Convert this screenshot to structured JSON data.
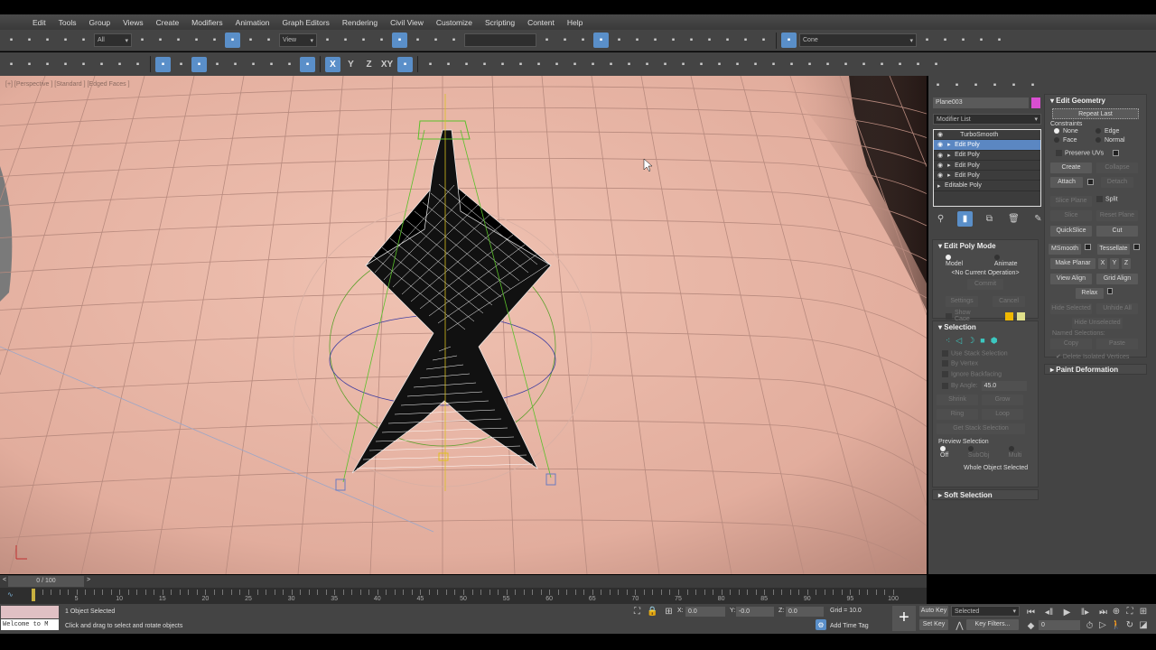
{
  "menu": [
    "Edit",
    "Tools",
    "Group",
    "Views",
    "Create",
    "Modifiers",
    "Animation",
    "Graph Editors",
    "Rendering",
    "Civil View",
    "Customize",
    "Scripting",
    "Content",
    "Help"
  ],
  "toolbar1": {
    "icons_left": [
      "undo-icon",
      "redo-icon",
      "link-icon",
      "unlink-icon",
      "bind-space-warp-icon"
    ],
    "selection_filter": "All",
    "icons_mid": [
      "select-object-icon",
      "select-by-name-icon",
      "rectangular-selection-icon",
      "window-crossing-icon",
      "move-icon",
      "rotate-icon",
      "scale-icon",
      "place-icon"
    ],
    "ref_coord": "View",
    "icons_right": [
      "pivot-center-icon",
      "manipulate-icon",
      "keyboard-shortcut-icon",
      "snap-3d-icon",
      "angle-snap-icon",
      "percent-snap-icon",
      "spinner-snap-icon",
      "named-selection-icon"
    ],
    "icons_far": [
      "mirror-icon",
      "align-icon",
      "scene-explorer-icon",
      "layer-explorer-icon",
      "toggle-ribbon-icon",
      "curve-editor-icon",
      "schematic-view-icon",
      "material-editor-icon",
      "render-setup-icon",
      "rendered-frame-icon",
      "render-icon",
      "render-cloud-icon",
      "render-pane-icon"
    ],
    "layer_label": "Cone",
    "icons_end": [
      "layer-icon",
      "create-layer-icon",
      "add-to-layer-icon",
      "select-in-layer-icon",
      "layer-props-icon"
    ]
  },
  "toolbar2": {
    "icons": [
      "scene-states-icon",
      "sphere-icon",
      "shirt-icon",
      "eraser-icon",
      "bone-icon",
      "keyframe-1-icon",
      "keyframe-2-icon",
      "keyframe-3-icon",
      "vertex-snap-icon",
      "pivot-snap-icon",
      "edge-snap-icon",
      "face-snap-icon",
      "polygon-snap-icon",
      "element-snap-icon",
      "perpendicular-snap-icon",
      "freeze-snap-icon",
      "axis-constraint-snap-icon"
    ],
    "axis": [
      "X",
      "Y",
      "Z",
      "XY"
    ],
    "icons2": [
      "grid-array-icon",
      "spacing-icon",
      "clone-icon",
      "teapot-icon",
      "render-frame-icon",
      "table-icon",
      "table2-icon",
      "light-icon",
      "camera-icon",
      "sound-icon",
      "film-icon",
      "plane-icon",
      "dome-icon",
      "disc-icon",
      "teapot-small-icon",
      "cone-icon",
      "sun-icon",
      "disc2-icon",
      "particles-icon",
      "molecule-icon",
      "pyramid-icon",
      "geosphere-icon",
      "grass-icon",
      "hair-icon",
      "cloth-icon",
      "sphere2-icon",
      "grid-window-icon",
      "info-icon",
      "help-icon"
    ]
  },
  "viewport": {
    "label": "[+] [Perspective ] [Standard ] [Edged Faces ]"
  },
  "command_panel": {
    "tabs": [
      "create-tab-icon",
      "modify-tab-icon",
      "hierarchy-tab-icon",
      "motion-tab-icon",
      "display-tab-icon",
      "utilities-tab-icon"
    ],
    "object_name": "Plane003",
    "object_color": "#d94fd1",
    "modifier_list": "Modifier List",
    "stack": [
      {
        "label": "TurboSmooth",
        "selected": false
      },
      {
        "label": "Edit Poly",
        "selected": true
      },
      {
        "label": "Edit Poly",
        "selected": false
      },
      {
        "label": "Edit Poly",
        "selected": false
      },
      {
        "label": "Edit Poly",
        "selected": false
      },
      {
        "label": "Editable Poly",
        "selected": false
      }
    ],
    "edit_poly_mode": {
      "title": "Edit Poly Mode",
      "model": "Model",
      "animate": "Animate",
      "operation": "<No Current Operation>",
      "commit": "Commit",
      "settings": "Settings",
      "cancel": "Cancel",
      "show_cage": "Show Cage"
    },
    "selection": {
      "title": "Selection",
      "use_stack": "Use Stack Selection",
      "by_vertex": "By Vertex",
      "ignore_backfacing": "Ignore Backfacing",
      "by_angle": "By Angle:",
      "angle": "45.0",
      "shrink": "Shrink",
      "grow": "Grow",
      "ring": "Ring",
      "loop": "Loop",
      "get_stack": "Get Stack Selection",
      "preview": "Preview Selection",
      "off": "Off",
      "subobj": "SubObj",
      "multi": "Multi",
      "status": "Whole Object Selected"
    },
    "soft_selection": "Soft Selection",
    "edit_geometry": {
      "title": "Edit Geometry",
      "repeat_last": "Repeat Last",
      "constraints": "Constraints",
      "none": "None",
      "edge": "Edge",
      "face": "Face",
      "normal": "Normal",
      "preserve_uvs": "Preserve UVs",
      "create": "Create",
      "collapse": "Collapse",
      "attach": "Attach",
      "detach": "Detach",
      "slice_plane": "Slice Plane",
      "split": "Split",
      "slice": "Slice",
      "reset_plane": "Reset Plane",
      "quickslice": "QuickSlice",
      "cut": "Cut",
      "msmooth": "MSmooth",
      "tessellate": "Tessellate",
      "make_planar": "Make Planar",
      "x": "X",
      "y": "Y",
      "z": "Z",
      "view_align": "View Align",
      "grid_align": "Grid Align",
      "relax": "Relax",
      "hide_selected": "Hide Selected",
      "unhide_all": "Unhide All",
      "hide_unselected": "Hide Unselected",
      "named_selections": "Named Selections:",
      "copy": "Copy",
      "paste": "Paste",
      "delete_isolated": "Delete Isolated Vertices"
    },
    "paint_deformation": "Paint Deformation"
  },
  "timeline": {
    "frame": "0 / 100",
    "prev": "<",
    "next": ">",
    "current": 0,
    "total": 100,
    "ticks": [
      "5",
      "10",
      "15",
      "20",
      "25",
      "30",
      "35",
      "40",
      "45",
      "50",
      "55",
      "60",
      "65",
      "70",
      "75",
      "80",
      "85",
      "90",
      "95",
      "100"
    ]
  },
  "status": {
    "script_listener": "Welcome to M",
    "selection": "1 Object Selected",
    "prompt": "Click and drag to select and rotate objects",
    "x_label": "X:",
    "x": "0.0",
    "y_label": "Y:",
    "y": "-0.0",
    "z_label": "Z:",
    "z": "0.0",
    "grid": "Grid = 10.0",
    "add_time_tag": "Add Time Tag",
    "auto_key": "Auto Key",
    "set_key": "Set Key",
    "key_mode": "Selected",
    "key_filters": "Key Filters...",
    "frame_field": "0"
  }
}
